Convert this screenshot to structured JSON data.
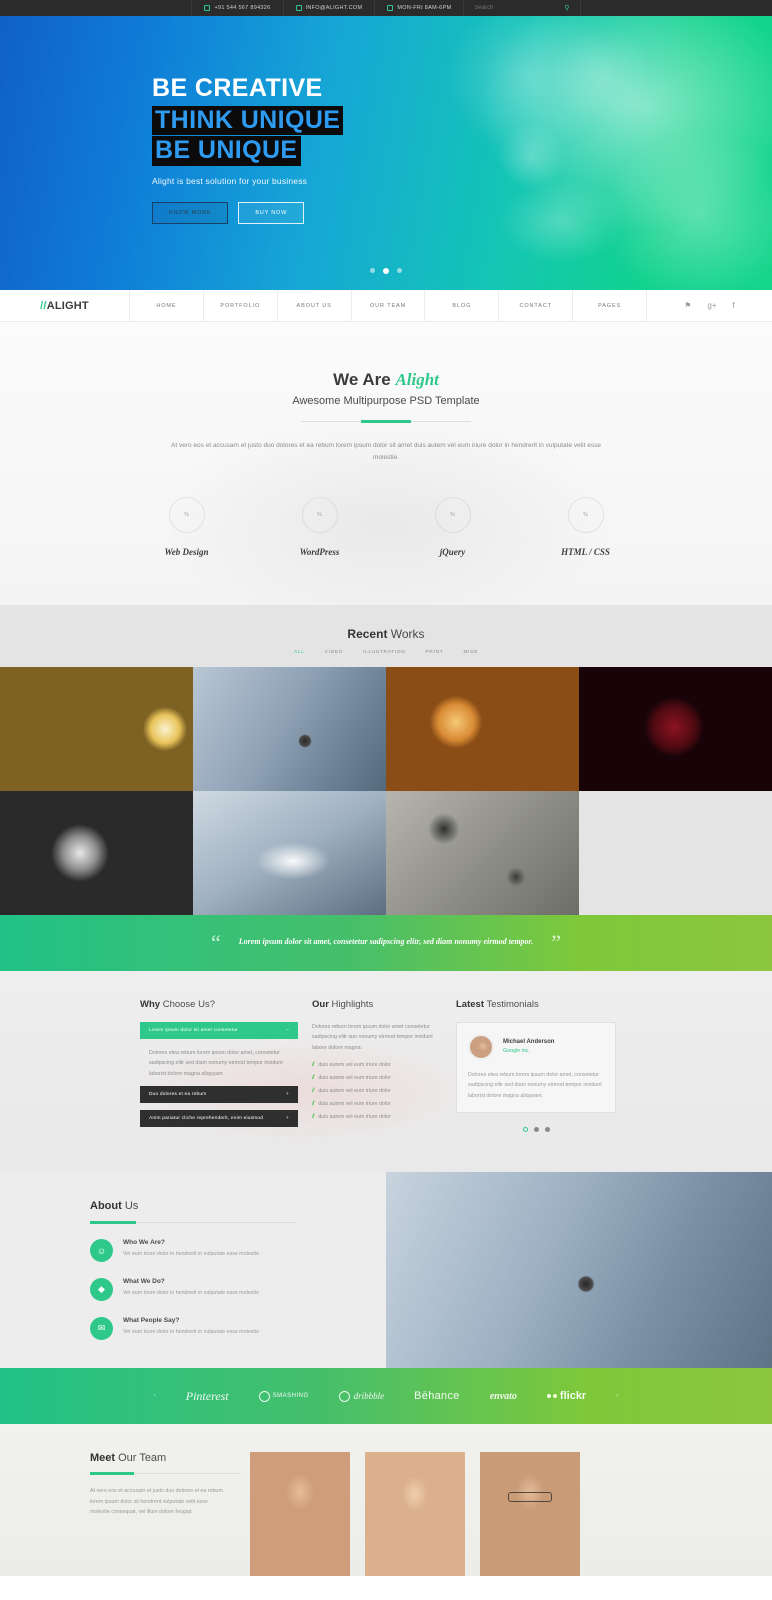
{
  "topbar": {
    "phone": "+91 544 567 894326",
    "email": "INFO@ALIGHT.COM",
    "hours": "MON-FRI 8AM-6PM",
    "search_placeholder": "Search",
    "search_value": "",
    "search_icon": "search-icon"
  },
  "hero": {
    "line1": "BE CREATIVE",
    "line2": "THINK UNIQUE",
    "line3": "BE UNIQUE",
    "subtitle": "Alight is best solution for your business",
    "btn_primary": "KNOW MORE",
    "btn_secondary": "BUY NOW",
    "slide_count": 3,
    "active_slide": 2
  },
  "nav": {
    "logo": "ALIGHT",
    "logo_prefix": "//",
    "items": [
      {
        "label": "HOME"
      },
      {
        "label": "PORTFOLIO"
      },
      {
        "label": "ABOUT US"
      },
      {
        "label": "OUR TEAM"
      },
      {
        "label": "BLOG"
      },
      {
        "label": "CONTACT"
      },
      {
        "label": "PAGES"
      }
    ],
    "social": [
      {
        "name": "twitter-icon",
        "glyph": "⚑"
      },
      {
        "name": "google-plus-icon",
        "glyph": "g+"
      },
      {
        "name": "facebook-icon",
        "glyph": "f"
      }
    ]
  },
  "weare": {
    "title_bold": "We Are ",
    "title_accent": "Alight",
    "subtitle": "Awesome Multipurpose PSD Template",
    "paragraph": "At vero eos et accusam et justo duo dolores et ea rebum lorem ipsum dolor sit amet duis autem vel eum iriure dolor in hendrerit in vulputate velit esse molestie.",
    "skills": [
      {
        "name": "Web Design",
        "value": "%"
      },
      {
        "name": "WordPress",
        "value": "%"
      },
      {
        "name": "jQuery",
        "value": "%"
      },
      {
        "name": "HTML / CSS",
        "value": "%"
      }
    ]
  },
  "works": {
    "title_bold": "Recent",
    "title_rest": " Works",
    "filters": [
      {
        "label": "ALL",
        "active": true
      },
      {
        "label": "VIDEO",
        "active": false
      },
      {
        "label": "ILLUSTRATION",
        "active": false
      },
      {
        "label": "PRINT",
        "active": false
      },
      {
        "label": "MISE",
        "active": false
      }
    ],
    "items": [
      {
        "name": "work-car-driver",
        "style": "ph-car"
      },
      {
        "name": "work-grey-coat",
        "style": "ph-coat"
      },
      {
        "name": "work-fried-food",
        "style": "ph-food"
      },
      {
        "name": "work-red-wine",
        "style": "ph-wine"
      },
      {
        "name": "work-dashboard",
        "style": "ph-dash"
      },
      {
        "name": "work-ring-light",
        "style": "ph-ring"
      },
      {
        "name": "work-desk-items",
        "style": "ph-desk"
      }
    ]
  },
  "quote": {
    "open_mark": "“",
    "close_mark": "”",
    "text": "Lorem ipsum dolor sit amet, consetetur sadipscing elitr, sed diam nonumy eirmod tempor."
  },
  "why": {
    "title_bold": "Why",
    "title_rest": " Choose Us?",
    "accordion": [
      {
        "label": "Lorem ipsum dolor sit amet consetetur",
        "sign": "–",
        "open": true,
        "body": "Dolores etea rebum lorem ipsum dolor amet, consetetur sadipscing elitr sed diam nonumy eirmod tempor invidunt laborist dolore magna aliquyam"
      },
      {
        "label": "Duo dolores et ea rebum",
        "sign": "+",
        "open": false,
        "body": ""
      },
      {
        "label": "Anim pariatur cliche reprehenderit, enim eiusmod",
        "sign": "+",
        "open": false,
        "body": ""
      }
    ]
  },
  "highlights": {
    "title_bold": "Our",
    "title_rest": " Highlights",
    "intro": "Dolores rebum lorem ipsum dolor amet consetetur sadipscing elitr iam nonumy eirmod tempor invidunt labore dolore magna:",
    "items": [
      "duis autem vel eum iriure dolor",
      "duis autem vel eum iriure dolor",
      "duis autem vel eum iriure dolor",
      "duis autem vel eum iriure dolor",
      "duis autem vel eum iriure dolor"
    ]
  },
  "testimonials": {
    "title_bold": "Latest",
    "title_rest": " Testimonials",
    "author": "Michael Anderson",
    "company": "Google inc.",
    "text": "Dolores etea rebum lorem ipsum dolor amet, consetetur sadipscing elitr sed diam nonumy eirmod tempor invidunt laborist dolore magna aliquyam.",
    "dot_count": 3,
    "active_dot": 1
  },
  "about": {
    "title_bold": "About",
    "title_rest": " Us",
    "items": [
      {
        "icon": "user-icon",
        "glyph": "☺",
        "title": "Who We Are?",
        "desc": "Vel eum iriure dolor in hendrerit in vulputate esse molestie"
      },
      {
        "icon": "diamond-icon",
        "glyph": "◆",
        "title": "What We Do?",
        "desc": "Vel eum iriure dolor in hendrerit in vulputate esse molestie"
      },
      {
        "icon": "chat-icon",
        "glyph": "✉",
        "title": "What People Say?",
        "desc": "Vel eum iriure dolor in hendrerit in vulputate esse molestie"
      }
    ],
    "image_name": "grey-coat-button-photo"
  },
  "brands": {
    "prev_arrow": "‹",
    "next_arrow": "›",
    "items": [
      {
        "name": "pinterest-logo",
        "label": "Pinterest"
      },
      {
        "name": "smashing-magazine-logo",
        "label": "SMASHING"
      },
      {
        "name": "dribbble-logo",
        "label": "dribbble"
      },
      {
        "name": "behance-logo",
        "label": "Bēhance"
      },
      {
        "name": "envato-logo",
        "label": "envato"
      },
      {
        "name": "flickr-logo",
        "label": "flickr"
      }
    ]
  },
  "team": {
    "title_bold": "Meet",
    "title_rest": " Our Team",
    "paragraph": "At vero eos et accusam et justo duo dolores et ea rebum lorem ipsum dolor sit hendrerit vulputate velit esse molestie consequat, vel illum dolore feugiat.",
    "members": [
      {
        "name": "team-member-1",
        "style": "m1",
        "glasses": false
      },
      {
        "name": "team-member-2",
        "style": "m2",
        "glasses": false
      },
      {
        "name": "team-member-3",
        "style": "m3",
        "glasses": true
      }
    ]
  }
}
